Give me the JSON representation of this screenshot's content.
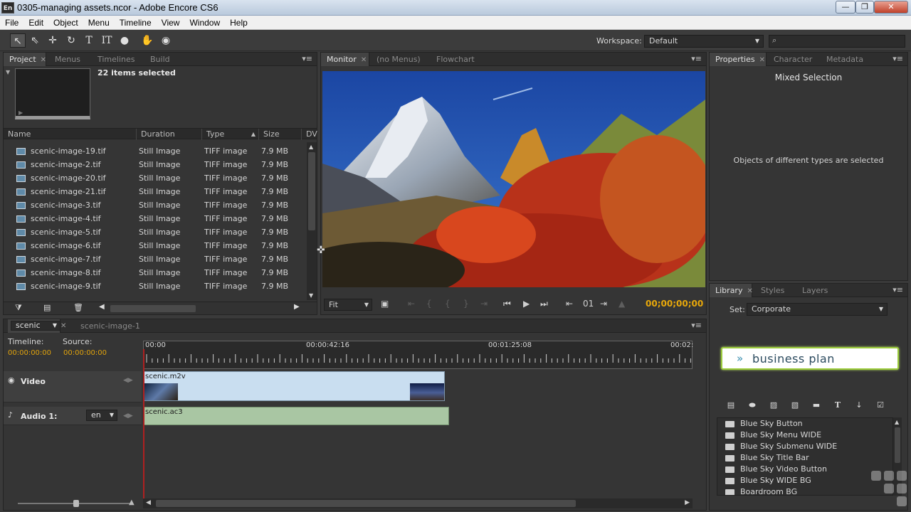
{
  "window": {
    "icon_label": "En",
    "title": "0305-managing assets.ncor - Adobe Encore CS6",
    "controls": [
      "—",
      "❐",
      "✕"
    ]
  },
  "menubar": [
    "File",
    "Edit",
    "Object",
    "Menu",
    "Timeline",
    "View",
    "Window",
    "Help"
  ],
  "toolbar": {
    "workspace_label": "Workspace:",
    "workspace_value": "Default",
    "search_placeholder": ""
  },
  "project_panel": {
    "tabs": [
      "Project",
      "Menus",
      "Timelines",
      "Build"
    ],
    "summary": "22 items selected",
    "columns": [
      "Name",
      "Duration",
      "Type",
      "Size",
      "DV"
    ],
    "rows": [
      {
        "name": "scenic-image-19.tif",
        "duration": "Still Image",
        "type": "TIFF image",
        "size": "7.9 MB"
      },
      {
        "name": "scenic-image-2.tif",
        "duration": "Still Image",
        "type": "TIFF image",
        "size": "7.9 MB"
      },
      {
        "name": "scenic-image-20.tif",
        "duration": "Still Image",
        "type": "TIFF image",
        "size": "7.9 MB"
      },
      {
        "name": "scenic-image-21.tif",
        "duration": "Still Image",
        "type": "TIFF image",
        "size": "7.9 MB"
      },
      {
        "name": "scenic-image-3.tif",
        "duration": "Still Image",
        "type": "TIFF image",
        "size": "7.9 MB"
      },
      {
        "name": "scenic-image-4.tif",
        "duration": "Still Image",
        "type": "TIFF image",
        "size": "7.9 MB"
      },
      {
        "name": "scenic-image-5.tif",
        "duration": "Still Image",
        "type": "TIFF image",
        "size": "7.9 MB"
      },
      {
        "name": "scenic-image-6.tif",
        "duration": "Still Image",
        "type": "TIFF image",
        "size": "7.9 MB"
      },
      {
        "name": "scenic-image-7.tif",
        "duration": "Still Image",
        "type": "TIFF image",
        "size": "7.9 MB"
      },
      {
        "name": "scenic-image-8.tif",
        "duration": "Still Image",
        "type": "TIFF image",
        "size": "7.9 MB"
      },
      {
        "name": "scenic-image-9.tif",
        "duration": "Still Image",
        "type": "TIFF image",
        "size": "7.9 MB"
      }
    ]
  },
  "monitor_panel": {
    "tabs": [
      "Monitor",
      "(no Menus)",
      "Flowchart"
    ],
    "fit_value": "Fit",
    "chapter": "01",
    "timecode": "00;00;00;00"
  },
  "properties_panel": {
    "tabs": [
      "Properties",
      "Character",
      "Metadata"
    ],
    "title": "Mixed Selection",
    "message": "Objects of different types are selected"
  },
  "library_panel": {
    "tabs": [
      "Library",
      "Styles",
      "Layers"
    ],
    "set_label": "Set:",
    "set_value": "Corporate",
    "preview_text": "business plan",
    "items": [
      "Blue Sky Button",
      "Blue Sky Menu WIDE",
      "Blue Sky Submenu WIDE",
      "Blue Sky Title Bar",
      "Blue Sky Video Button",
      "Blue Sky WIDE BG",
      "Boardroom BG"
    ]
  },
  "timeline_panel": {
    "tabs": [
      "scenic",
      "scenic-image-1"
    ],
    "timeline_label": "Timeline:",
    "source_label": "Source:",
    "timeline_tc": "00:00:00:00",
    "source_tc": "00:00:00:00",
    "ruler_labels": [
      "00:00",
      "00:00:42:16",
      "00:01:25:08",
      "00:02:"
    ],
    "video_track": "Video",
    "audio_track": "Audio 1:",
    "audio_lang": "en",
    "video_clip": "scenic.m2v",
    "audio_clip": "scenic.ac3"
  },
  "colors": {
    "accent_timecode": "#e8a80a",
    "playhead": "#b02020",
    "video_clip": "#c9def0",
    "audio_clip": "#a9c6a3",
    "library_highlight": "#9ccc3c"
  }
}
